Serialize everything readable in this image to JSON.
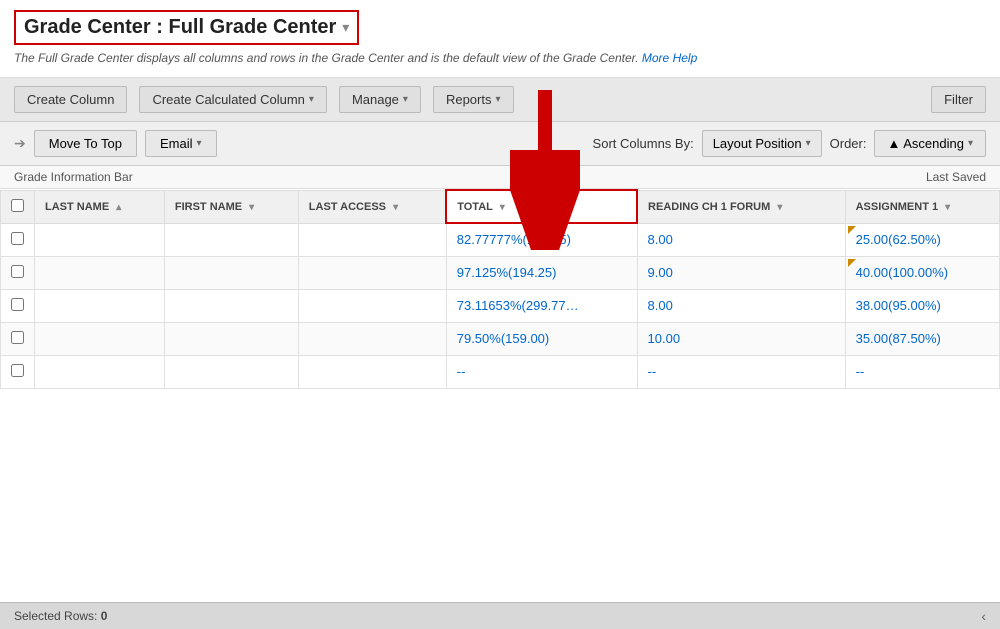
{
  "header": {
    "title": "Grade Center : Full Grade Center",
    "chevron": "▾",
    "description": "The Full Grade Center displays all columns and rows in the Grade Center and is the default view of the Grade Center.",
    "more_help": "More Help"
  },
  "toolbar": {
    "create_column": "Create Column",
    "create_calculated_column": "Create Calculated Column",
    "create_calc_arrow": "▾",
    "manage": "Manage",
    "manage_arrow": "▾",
    "reports": "Reports",
    "reports_arrow": "▾",
    "filter": "Filter"
  },
  "action_bar": {
    "move_to_top": "Move To Top",
    "email": "Email",
    "email_arrow": "▾",
    "sort_columns_by_label": "Sort Columns By:",
    "sort_value": "Layout Position",
    "sort_arrow": "▾",
    "order_label": "Order:",
    "order_value": "▲ Ascending",
    "order_arrow": "▾"
  },
  "info_bar": {
    "left": "Grade Information Bar",
    "right": "Last Saved"
  },
  "table": {
    "columns": [
      {
        "label": "",
        "type": "checkbox"
      },
      {
        "label": "LAST NAME",
        "sort": true
      },
      {
        "label": "FIRST NAME",
        "sort": true
      },
      {
        "label": "LAST ACCESS",
        "sort": true
      },
      {
        "label": "TOTAL",
        "sort": true,
        "highlighted": true
      },
      {
        "label": "READING CH 1 FORUM",
        "sort": true
      },
      {
        "label": "ASSIGNMENT 1",
        "sort": true
      }
    ],
    "rows": [
      {
        "check": false,
        "last_name": "",
        "first_name": "",
        "last_access": "",
        "total": "82.77777%(186.25)",
        "forum": "8.00",
        "assignment": "25.00(62.50%)",
        "assignment_flag": true
      },
      {
        "check": false,
        "last_name": "",
        "first_name": "",
        "last_access": "",
        "total": "97.125%(194.25)",
        "forum": "9.00",
        "assignment": "40.00(100.00%)",
        "assignment_flag": true
      },
      {
        "check": false,
        "last_name": "",
        "first_name": "",
        "last_access": "",
        "total": "73.11653%(299.77…",
        "forum": "8.00",
        "assignment": "38.00(95.00%)",
        "assignment_flag": false
      },
      {
        "check": false,
        "last_name": "",
        "first_name": "",
        "last_access": "",
        "total": "79.50%(159.00)",
        "forum": "10.00",
        "assignment": "35.00(87.50%)",
        "assignment_flag": false
      },
      {
        "check": false,
        "last_name": "",
        "first_name": "",
        "last_access": "",
        "total": "--",
        "forum": "--",
        "assignment": "--",
        "assignment_flag": false
      }
    ]
  },
  "footer": {
    "selected_rows_label": "Selected Rows:",
    "selected_rows_value": "0",
    "scroll_left": "‹"
  }
}
